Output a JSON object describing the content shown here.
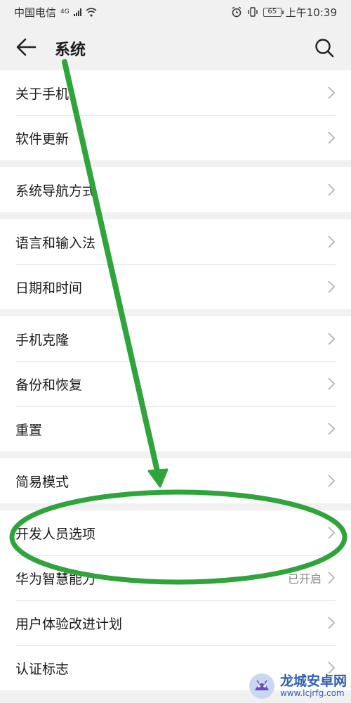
{
  "status_bar": {
    "carrier": "中国电信",
    "network": "4G",
    "battery": "65",
    "time": "上午10:39"
  },
  "app_bar": {
    "title": "系统",
    "back_icon": "arrow-left-icon",
    "search_icon": "search-icon"
  },
  "groups": [
    {
      "items": [
        {
          "label": "关于手机"
        },
        {
          "label": "软件更新"
        }
      ]
    },
    {
      "items": [
        {
          "label": "系统导航方式"
        }
      ]
    },
    {
      "items": [
        {
          "label": "语言和输入法"
        },
        {
          "label": "日期和时间"
        }
      ]
    },
    {
      "items": [
        {
          "label": "手机克隆"
        },
        {
          "label": "备份和恢复"
        },
        {
          "label": "重置"
        }
      ]
    },
    {
      "items": [
        {
          "label": "简易模式"
        }
      ]
    },
    {
      "items": [
        {
          "label": "开发人员选项"
        },
        {
          "label": "华为智慧能力",
          "value": "已开启"
        },
        {
          "label": "用户体验改进计划"
        },
        {
          "label": "认证标志"
        }
      ]
    }
  ],
  "annotation": {
    "color": "#2ea43a",
    "highlighted_item": "开发人员选项"
  },
  "watermark": {
    "name": "龙城安卓网",
    "url": "www.lcjrfg.com"
  }
}
